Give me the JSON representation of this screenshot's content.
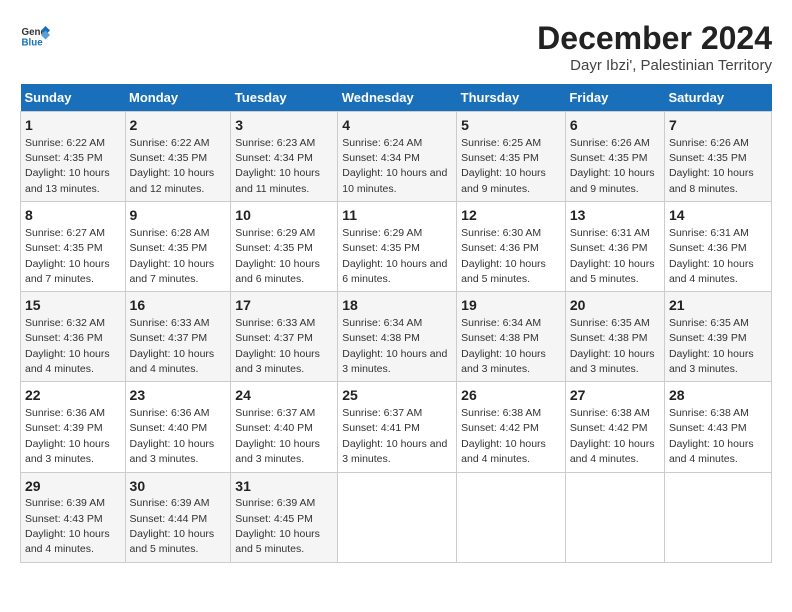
{
  "logo": {
    "text_general": "General",
    "text_blue": "Blue"
  },
  "title": "December 2024",
  "subtitle": "Dayr Ibzi', Palestinian Territory",
  "days_of_week": [
    "Sunday",
    "Monday",
    "Tuesday",
    "Wednesday",
    "Thursday",
    "Friday",
    "Saturday"
  ],
  "weeks": [
    [
      {
        "day": "1",
        "sunrise": "Sunrise: 6:22 AM",
        "sunset": "Sunset: 4:35 PM",
        "daylight": "Daylight: 10 hours and 13 minutes."
      },
      {
        "day": "2",
        "sunrise": "Sunrise: 6:22 AM",
        "sunset": "Sunset: 4:35 PM",
        "daylight": "Daylight: 10 hours and 12 minutes."
      },
      {
        "day": "3",
        "sunrise": "Sunrise: 6:23 AM",
        "sunset": "Sunset: 4:34 PM",
        "daylight": "Daylight: 10 hours and 11 minutes."
      },
      {
        "day": "4",
        "sunrise": "Sunrise: 6:24 AM",
        "sunset": "Sunset: 4:34 PM",
        "daylight": "Daylight: 10 hours and 10 minutes."
      },
      {
        "day": "5",
        "sunrise": "Sunrise: 6:25 AM",
        "sunset": "Sunset: 4:35 PM",
        "daylight": "Daylight: 10 hours and 9 minutes."
      },
      {
        "day": "6",
        "sunrise": "Sunrise: 6:26 AM",
        "sunset": "Sunset: 4:35 PM",
        "daylight": "Daylight: 10 hours and 9 minutes."
      },
      {
        "day": "7",
        "sunrise": "Sunrise: 6:26 AM",
        "sunset": "Sunset: 4:35 PM",
        "daylight": "Daylight: 10 hours and 8 minutes."
      }
    ],
    [
      {
        "day": "8",
        "sunrise": "Sunrise: 6:27 AM",
        "sunset": "Sunset: 4:35 PM",
        "daylight": "Daylight: 10 hours and 7 minutes."
      },
      {
        "day": "9",
        "sunrise": "Sunrise: 6:28 AM",
        "sunset": "Sunset: 4:35 PM",
        "daylight": "Daylight: 10 hours and 7 minutes."
      },
      {
        "day": "10",
        "sunrise": "Sunrise: 6:29 AM",
        "sunset": "Sunset: 4:35 PM",
        "daylight": "Daylight: 10 hours and 6 minutes."
      },
      {
        "day": "11",
        "sunrise": "Sunrise: 6:29 AM",
        "sunset": "Sunset: 4:35 PM",
        "daylight": "Daylight: 10 hours and 6 minutes."
      },
      {
        "day": "12",
        "sunrise": "Sunrise: 6:30 AM",
        "sunset": "Sunset: 4:36 PM",
        "daylight": "Daylight: 10 hours and 5 minutes."
      },
      {
        "day": "13",
        "sunrise": "Sunrise: 6:31 AM",
        "sunset": "Sunset: 4:36 PM",
        "daylight": "Daylight: 10 hours and 5 minutes."
      },
      {
        "day": "14",
        "sunrise": "Sunrise: 6:31 AM",
        "sunset": "Sunset: 4:36 PM",
        "daylight": "Daylight: 10 hours and 4 minutes."
      }
    ],
    [
      {
        "day": "15",
        "sunrise": "Sunrise: 6:32 AM",
        "sunset": "Sunset: 4:36 PM",
        "daylight": "Daylight: 10 hours and 4 minutes."
      },
      {
        "day": "16",
        "sunrise": "Sunrise: 6:33 AM",
        "sunset": "Sunset: 4:37 PM",
        "daylight": "Daylight: 10 hours and 4 minutes."
      },
      {
        "day": "17",
        "sunrise": "Sunrise: 6:33 AM",
        "sunset": "Sunset: 4:37 PM",
        "daylight": "Daylight: 10 hours and 3 minutes."
      },
      {
        "day": "18",
        "sunrise": "Sunrise: 6:34 AM",
        "sunset": "Sunset: 4:38 PM",
        "daylight": "Daylight: 10 hours and 3 minutes."
      },
      {
        "day": "19",
        "sunrise": "Sunrise: 6:34 AM",
        "sunset": "Sunset: 4:38 PM",
        "daylight": "Daylight: 10 hours and 3 minutes."
      },
      {
        "day": "20",
        "sunrise": "Sunrise: 6:35 AM",
        "sunset": "Sunset: 4:38 PM",
        "daylight": "Daylight: 10 hours and 3 minutes."
      },
      {
        "day": "21",
        "sunrise": "Sunrise: 6:35 AM",
        "sunset": "Sunset: 4:39 PM",
        "daylight": "Daylight: 10 hours and 3 minutes."
      }
    ],
    [
      {
        "day": "22",
        "sunrise": "Sunrise: 6:36 AM",
        "sunset": "Sunset: 4:39 PM",
        "daylight": "Daylight: 10 hours and 3 minutes."
      },
      {
        "day": "23",
        "sunrise": "Sunrise: 6:36 AM",
        "sunset": "Sunset: 4:40 PM",
        "daylight": "Daylight: 10 hours and 3 minutes."
      },
      {
        "day": "24",
        "sunrise": "Sunrise: 6:37 AM",
        "sunset": "Sunset: 4:40 PM",
        "daylight": "Daylight: 10 hours and 3 minutes."
      },
      {
        "day": "25",
        "sunrise": "Sunrise: 6:37 AM",
        "sunset": "Sunset: 4:41 PM",
        "daylight": "Daylight: 10 hours and 3 minutes."
      },
      {
        "day": "26",
        "sunrise": "Sunrise: 6:38 AM",
        "sunset": "Sunset: 4:42 PM",
        "daylight": "Daylight: 10 hours and 4 minutes."
      },
      {
        "day": "27",
        "sunrise": "Sunrise: 6:38 AM",
        "sunset": "Sunset: 4:42 PM",
        "daylight": "Daylight: 10 hours and 4 minutes."
      },
      {
        "day": "28",
        "sunrise": "Sunrise: 6:38 AM",
        "sunset": "Sunset: 4:43 PM",
        "daylight": "Daylight: 10 hours and 4 minutes."
      }
    ],
    [
      {
        "day": "29",
        "sunrise": "Sunrise: 6:39 AM",
        "sunset": "Sunset: 4:43 PM",
        "daylight": "Daylight: 10 hours and 4 minutes."
      },
      {
        "day": "30",
        "sunrise": "Sunrise: 6:39 AM",
        "sunset": "Sunset: 4:44 PM",
        "daylight": "Daylight: 10 hours and 5 minutes."
      },
      {
        "day": "31",
        "sunrise": "Sunrise: 6:39 AM",
        "sunset": "Sunset: 4:45 PM",
        "daylight": "Daylight: 10 hours and 5 minutes."
      },
      null,
      null,
      null,
      null
    ]
  ]
}
